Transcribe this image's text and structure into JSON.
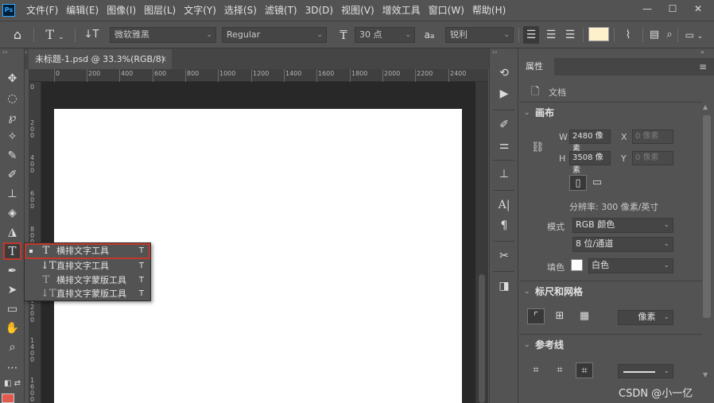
{
  "app": {
    "logo": "Ps"
  },
  "menu": [
    "文件(F)",
    "编辑(E)",
    "图像(I)",
    "图层(L)",
    "文字(Y)",
    "选择(S)",
    "滤镜(T)",
    "3D(D)",
    "视图(V)",
    "增效工具",
    "窗口(W)",
    "帮助(H)"
  ],
  "window_controls": {
    "minimize": "—",
    "maximize": "☐",
    "close": "✕"
  },
  "options_bar": {
    "font_family": "微软雅黑",
    "font_style": "Regular",
    "font_size": "30 点",
    "antialias_icon_text": "a",
    "antialias_icon_small": "a",
    "antialias": "锐利",
    "text_color": "#fdf1cc"
  },
  "document_tab": {
    "title": "未标题-1.psd @ 33.3%(RGB/8)",
    "close": "×"
  },
  "ruler_top": [
    "0",
    "200",
    "400",
    "600",
    "800",
    "1000",
    "1200",
    "1400",
    "1600",
    "1800",
    "2000",
    "2200",
    "2400"
  ],
  "ruler_left": [
    "0",
    "200",
    "400",
    "600",
    "800",
    "1000",
    "1200",
    "1400",
    "1600"
  ],
  "flyout": [
    {
      "icon": "T",
      "label": "横排文字工具",
      "key": "T",
      "selected": true
    },
    {
      "icon": "↓T",
      "label": "直排文字工具",
      "key": "T"
    },
    {
      "icon": "T",
      "label": "横排文字蒙版工具",
      "key": "T"
    },
    {
      "icon": "↓T",
      "label": "直排文字蒙版工具",
      "key": "T"
    }
  ],
  "properties": {
    "tab_label": "属性",
    "doc_label": "文档",
    "canvas": {
      "title": "画布",
      "w_label": "W",
      "w_value": "2480 像素",
      "h_label": "H",
      "h_value": "3508 像素",
      "x_label": "X",
      "x_placeholder": "0 像素",
      "y_label": "Y",
      "y_placeholder": "0 像素",
      "resolution": "分辨率: 300 像素/英寸",
      "mode_label": "模式",
      "mode_value": "RGB 颜色",
      "depth_value": "8 位/通道",
      "fill_label": "填色",
      "fill_value": "白色"
    },
    "rulers_grids": {
      "title": "标尺和网格",
      "unit": "像素"
    },
    "guides": {
      "title": "参考线"
    }
  },
  "watermark": "CSDN @小一亿",
  "colors": {
    "foreground": "#e05a4f",
    "selection_outline": "#c0392b"
  }
}
